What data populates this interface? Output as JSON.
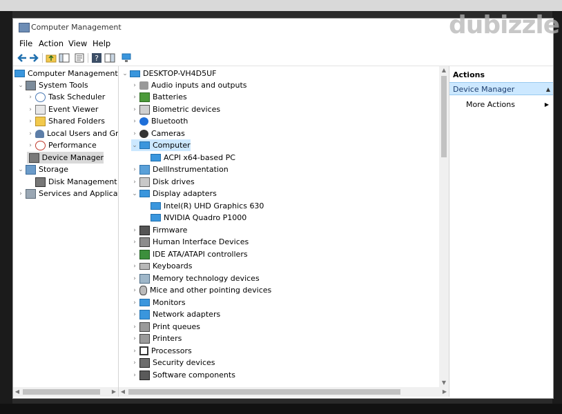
{
  "window": {
    "title": "Computer Management"
  },
  "menu": {
    "file": "File",
    "action": "Action",
    "view": "View",
    "help": "Help"
  },
  "tree": {
    "root": "Computer Management (Lo",
    "items": [
      {
        "label": "System Tools",
        "icon": "tools-icon"
      },
      {
        "label": "Task Scheduler",
        "icon": "clock-icon"
      },
      {
        "label": "Event Viewer",
        "icon": "log-icon"
      },
      {
        "label": "Shared Folders",
        "icon": "folder-icon"
      },
      {
        "label": "Local Users and Grou",
        "icon": "users-icon"
      },
      {
        "label": "Performance",
        "icon": "performance-icon"
      },
      {
        "label": "Device Manager",
        "icon": "device-manager-icon"
      },
      {
        "label": "Storage",
        "icon": "storage-icon"
      },
      {
        "label": "Disk Management",
        "icon": "disk-icon"
      },
      {
        "label": "Services and Application",
        "icon": "services-icon"
      }
    ]
  },
  "devices": {
    "host": "DESKTOP-VH4D5UF",
    "categories": [
      "Audio inputs and outputs",
      "Batteries",
      "Biometric devices",
      "Bluetooth",
      "Cameras",
      "Computer",
      "ACPI x64-based PC",
      "DellInstrumentation",
      "Disk drives",
      "Display adapters",
      "Intel(R) UHD Graphics 630",
      "NVIDIA Quadro P1000",
      "Firmware",
      "Human Interface Devices",
      "IDE ATA/ATAPI controllers",
      "Keyboards",
      "Memory technology devices",
      "Mice and other pointing devices",
      "Monitors",
      "Network adapters",
      "Print queues",
      "Printers",
      "Processors",
      "Security devices",
      "Software components"
    ]
  },
  "actions": {
    "header": "Actions",
    "selected": "Device Manager",
    "more": "More Actions"
  },
  "watermark": "dubizzle",
  "colors": {
    "selection": "#cce8ff",
    "accent": "#3a96dd"
  }
}
